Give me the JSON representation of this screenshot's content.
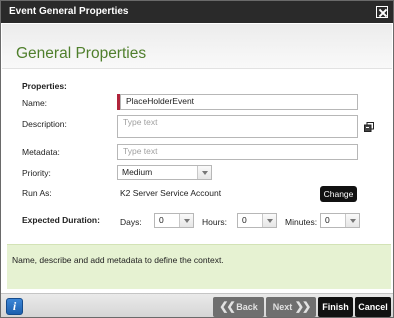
{
  "window": {
    "title": "Event General Properties"
  },
  "header": {
    "title": "General Properties"
  },
  "form": {
    "properties_heading": "Properties:",
    "name": {
      "label": "Name:",
      "value": "PlaceHolderEvent"
    },
    "description": {
      "label": "Description:",
      "placeholder": "Type text"
    },
    "metadata": {
      "label": "Metadata:",
      "placeholder": "Type text"
    },
    "priority": {
      "label": "Priority:",
      "value": "Medium"
    },
    "run_as": {
      "label": "Run As:",
      "value": "K2 Server Service Account",
      "change_label": "Change"
    },
    "expected_duration": {
      "label": "Expected Duration:",
      "days_label": "Days:",
      "days_value": "0",
      "hours_label": "Hours:",
      "hours_value": "0",
      "minutes_label": "Minutes:",
      "minutes_value": "0"
    }
  },
  "info": {
    "text": "Name, describe and add metadata to define the context."
  },
  "footer": {
    "info_button": "i",
    "back_label": "Back",
    "next_label": "Next",
    "finish_label": "Finish",
    "cancel_label": "Cancel"
  },
  "colors": {
    "title_bar": "#2a2a2a",
    "section_title": "#4f7f2c",
    "required": "#b0243b",
    "info_band": "#e6f2d2"
  }
}
